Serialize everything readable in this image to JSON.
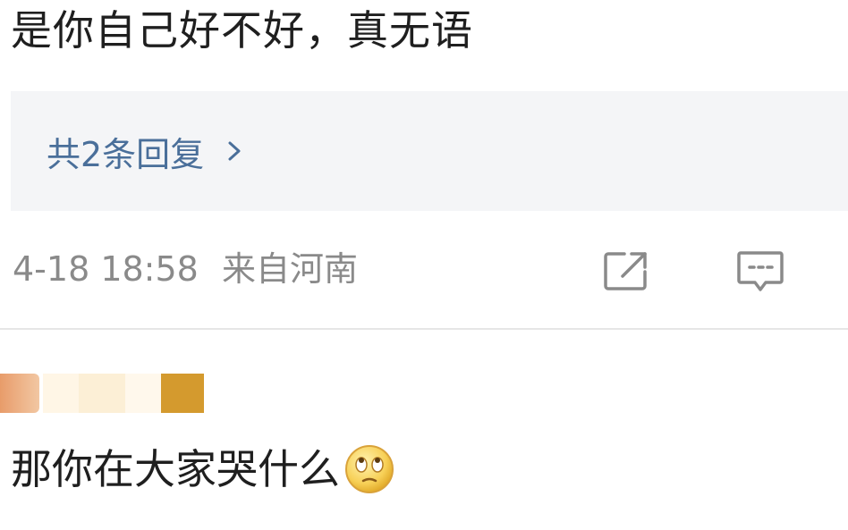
{
  "comment": {
    "text": "是你自己好不好，真无语"
  },
  "replies": {
    "label": "共2条回复",
    "chevron_icon": "chevron-right-icon"
  },
  "meta": {
    "timestamp": "4-18 18:58",
    "location": "来自河南"
  },
  "actions": {
    "share_icon": "share-icon",
    "reply_icon": "comment-icon"
  },
  "next_comment": {
    "text": "那你在大家哭什么",
    "emoji_icon": "eye-roll-emoji-icon"
  },
  "colors": {
    "link": "#4a6f9a",
    "meta": "#8a8a8a",
    "reply_box_bg": "#f4f5f7"
  }
}
